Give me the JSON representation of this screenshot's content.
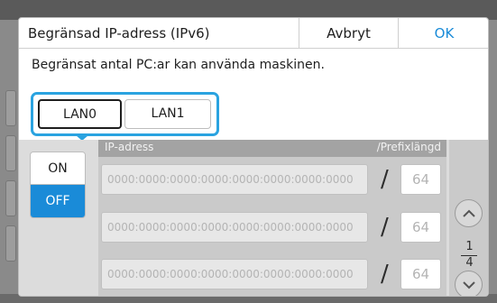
{
  "dialog": {
    "title": "Begränsad IP-adress (IPv6)",
    "cancel_label": "Avbryt",
    "ok_label": "OK",
    "description": "Begränsat antal PC:ar kan använda maskinen."
  },
  "lan_tabs": [
    {
      "label": "LAN0",
      "selected": true
    },
    {
      "label": "LAN1",
      "selected": false
    }
  ],
  "toggle": {
    "on_label": "ON",
    "off_label": "OFF",
    "selected": "OFF"
  },
  "table": {
    "ip_header": "IP-adress",
    "prefix_header": "/Prefixlängd",
    "rows": [
      {
        "ip_placeholder": "0000:0000:0000:0000:0000:0000:0000:0000",
        "slash": "/",
        "prefix": "64"
      },
      {
        "ip_placeholder": "0000:0000:0000:0000:0000:0000:0000:0000",
        "slash": "/",
        "prefix": "64"
      },
      {
        "ip_placeholder": "0000:0000:0000:0000:0000:0000:0000:0000",
        "slash": "/",
        "prefix": "64"
      }
    ]
  },
  "pager": {
    "current": "1",
    "total": "4",
    "up_icon": "chevron-up-icon",
    "down_icon": "chevron-down-icon"
  },
  "colors": {
    "accent": "#1a8bd8",
    "highlight": "#2aa3e0",
    "content_bg": "#dcdcdc"
  }
}
